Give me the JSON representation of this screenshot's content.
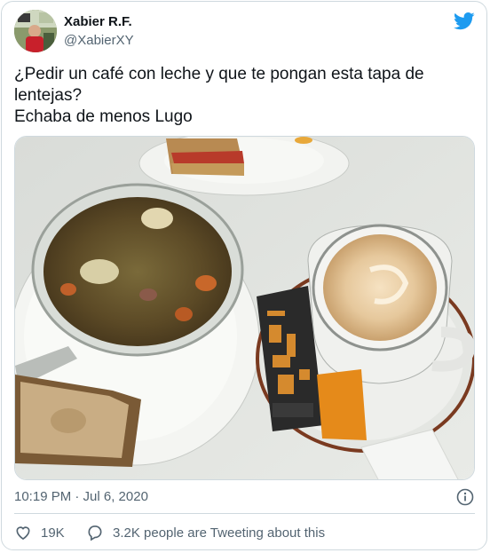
{
  "author": {
    "display_name": "Xabier R.F.",
    "handle": "@XabierXY",
    "avatar_icon": "user-avatar"
  },
  "brand": {
    "icon": "twitter-bird-icon",
    "color": "#1d9bf0"
  },
  "tweet": {
    "text": "¿Pedir un café con leche y que te pongan esta tapa de lentejas?\nEchaba de menos Lugo"
  },
  "meta": {
    "timestamp": "10:19 PM · Jul 6, 2020",
    "info_icon": "info-icon"
  },
  "engagement": {
    "likes_count": "19K",
    "conversation_text": "3.2K people are Tweeting about this"
  },
  "colors": {
    "text": "#0f1419",
    "muted": "#536471",
    "border": "#cfd9de"
  }
}
